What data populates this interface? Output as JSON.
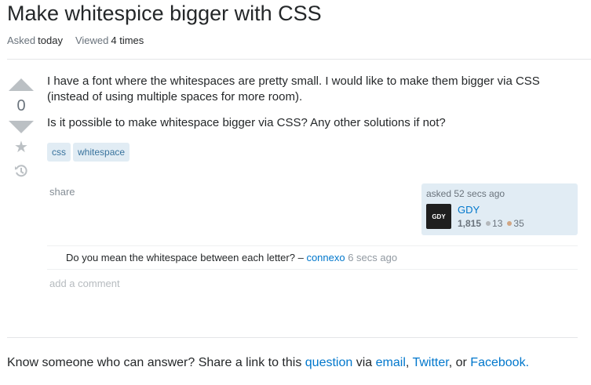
{
  "question": {
    "title": "Make whitespice bigger with CSS",
    "asked_label": "Asked",
    "asked_value": "today",
    "viewed_label": "Viewed",
    "viewed_value": "4 times",
    "vote_count": "0",
    "body": [
      "I have a font where the whitespaces are pretty small. I would like to make them bigger via CSS (instead of using multiple spaces for more room).",
      "Is it possible to make whitespace bigger via CSS? Any other solutions if not?"
    ],
    "tags": [
      "css",
      "whitespace"
    ],
    "share_label": "share"
  },
  "owner": {
    "asked_time": "asked 52 secs ago",
    "avatar_text": "GDY",
    "name": "GDY",
    "reputation": "1,815",
    "silver": "13",
    "bronze": "35"
  },
  "comment": {
    "text": "Do you mean the whitespace between each letter? –",
    "user": "connexo",
    "time": "6 secs ago"
  },
  "add_comment_label": "add a comment",
  "footer": {
    "prefix": "Know someone who can answer? Share a link to this",
    "link_question": "question",
    "via": "via",
    "link_email": "email",
    "comma1": ",",
    "link_twitter": "Twitter",
    "or": ", or",
    "link_facebook": "Facebook."
  },
  "icons": {
    "upvote": "upvote-arrow-icon",
    "downvote": "downvote-arrow-icon",
    "favorite": "star-icon",
    "history": "history-icon"
  }
}
